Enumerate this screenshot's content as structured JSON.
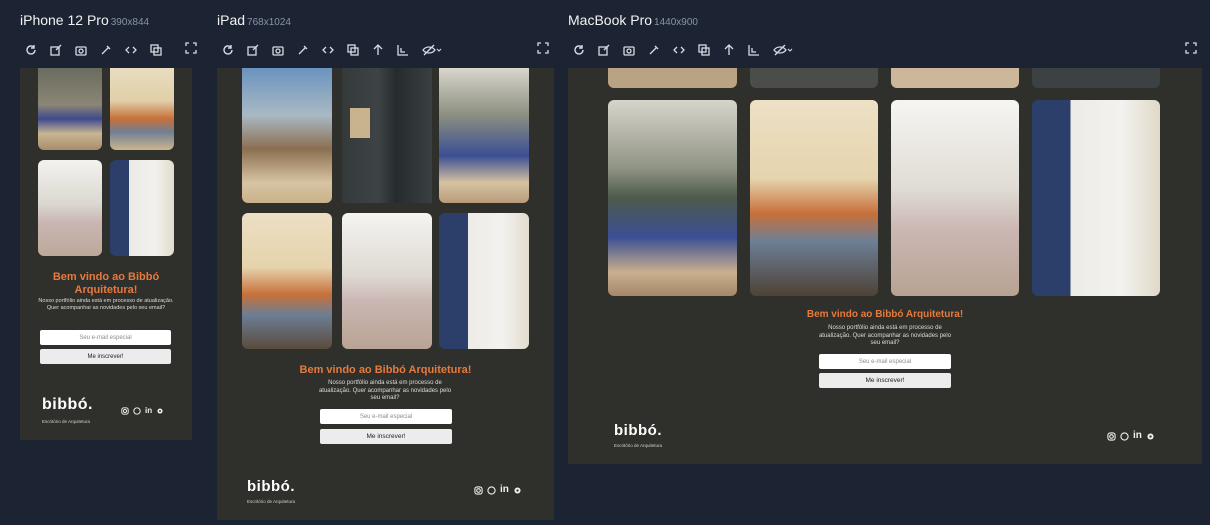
{
  "devices": [
    {
      "name": "iPhone 12 Pro",
      "size": "390x844"
    },
    {
      "name": "iPad",
      "size": "768x1024"
    },
    {
      "name": "MacBook Pro",
      "size": "1440x900"
    }
  ],
  "site": {
    "welcome": "Bem vindo ao Bibbó Arquitetura!",
    "welcome_line1": "Bem vindo ao Bibbó",
    "welcome_line2": "Arquitetura!",
    "description": "Nosso portfólio ainda está em processo de atualização. Quer acompanhar as novidades pelo seu email?",
    "email_placeholder": "Seu e-mail especial",
    "subscribe_label": "Me inscrever!",
    "logo": "bibbó.",
    "logo_sub": "Escritório de Arquitetura",
    "social_in": "in"
  },
  "colors": {
    "background": "#1c2434",
    "frame": "#2f2f2b",
    "accent": "#e77a3d"
  },
  "icons": {
    "toolbar_phone": [
      "reload-icon",
      "edit-screenshot-icon",
      "camera-icon",
      "eyedropper-icon",
      "code-icon",
      "copy-icon"
    ],
    "toolbar_tablet": [
      "reload-icon",
      "edit-screenshot-icon",
      "camera-icon",
      "eyedropper-icon",
      "code-icon",
      "copy-icon",
      "arrow-up-icon",
      "layout-icon",
      "hide-icon"
    ],
    "fullscreen": "fullscreen-icon",
    "social": [
      "instagram-icon",
      "whatsapp-icon",
      "linkedin-icon",
      "settings-icon"
    ]
  }
}
